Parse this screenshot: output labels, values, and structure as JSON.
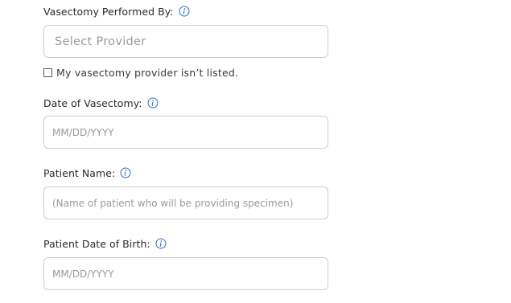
{
  "form": {
    "provider": {
      "label": "Vasectomy Performed By:",
      "select_placeholder": "Select Provider",
      "not_listed_label": "My vasectomy provider isn’t listed."
    },
    "vasectomy_date": {
      "label": "Date of Vasectomy:",
      "placeholder": "MM/DD/YYYY"
    },
    "patient_name": {
      "label": "Patient Name:",
      "placeholder": "(Name of patient who will be providing specimen)"
    },
    "patient_dob": {
      "label": "Patient Date of Birth:",
      "placeholder": "MM/DD/YYYY"
    }
  },
  "icons": {
    "info": "info-icon"
  },
  "colors": {
    "info_icon": "#2f6ec2",
    "field_border": "#cfcfcf",
    "placeholder": "#9a9a9a",
    "label": "#2b2b2b"
  }
}
